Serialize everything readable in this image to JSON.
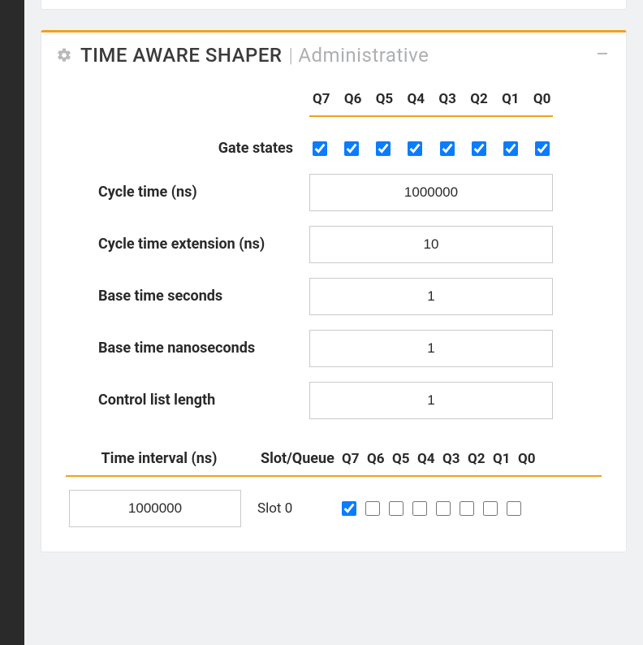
{
  "panel": {
    "title_main": "TIME AWARE SHAPER",
    "title_sep": "|",
    "title_sub": "Administrative"
  },
  "queues": [
    "Q7",
    "Q6",
    "Q5",
    "Q4",
    "Q3",
    "Q2",
    "Q1",
    "Q0"
  ],
  "gate_states": {
    "label": "Gate states",
    "checked": [
      true,
      true,
      true,
      true,
      true,
      true,
      true,
      true
    ]
  },
  "fields": {
    "cycle_time": {
      "label": "Cycle time (ns)",
      "value": "1000000"
    },
    "cycle_time_ext": {
      "label": "Cycle time extension (ns)",
      "value": "10"
    },
    "base_sec": {
      "label": "Base time seconds",
      "value": "1"
    },
    "base_nsec": {
      "label": "Base time nanoseconds",
      "value": "1"
    },
    "ctrl_len": {
      "label": "Control list length",
      "value": "1"
    }
  },
  "lower": {
    "time_interval_label": "Time interval (ns)",
    "slot_queue_label": "Slot/Queue",
    "row": {
      "time_interval": "1000000",
      "slot_label": "Slot 0",
      "checked": [
        true,
        false,
        false,
        false,
        false,
        false,
        false,
        false
      ]
    }
  }
}
